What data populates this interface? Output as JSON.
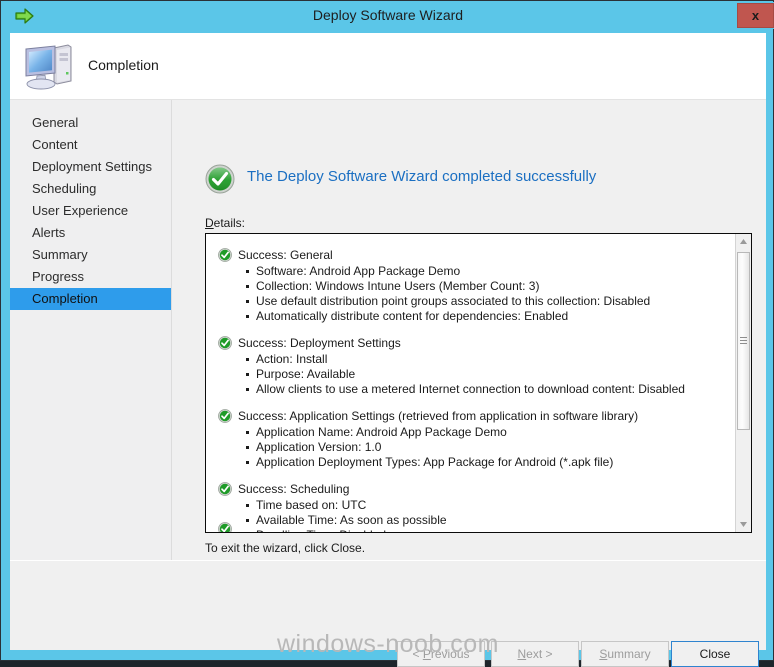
{
  "window": {
    "title": "Deploy Software Wizard",
    "app_icon": "green-arrow-icon",
    "close_label": "x",
    "frame_color": "#5bc6e8",
    "close_button_color": "#c0564f"
  },
  "header": {
    "title": "Completion",
    "icon": "computer-icon"
  },
  "sidebar": {
    "items": [
      {
        "label": "General",
        "selected": false
      },
      {
        "label": "Content",
        "selected": false
      },
      {
        "label": "Deployment Settings",
        "selected": false
      },
      {
        "label": "Scheduling",
        "selected": false
      },
      {
        "label": "User Experience",
        "selected": false
      },
      {
        "label": "Alerts",
        "selected": false
      },
      {
        "label": "Summary",
        "selected": false
      },
      {
        "label": "Progress",
        "selected": false
      },
      {
        "label": "Completion",
        "selected": true
      }
    ],
    "selected_color": "#2e9ceb"
  },
  "main": {
    "success_message": "The Deploy Software Wizard completed successfully",
    "success_message_color": "#1b6fc2",
    "success_icon": "green-check-circle-icon",
    "details_label_accel": "D",
    "details_label_rest": "etails:",
    "exit_text": "To exit the wizard, click Close.",
    "detail_groups": [
      {
        "icon": "green-check-circle-icon",
        "heading": "Success: General",
        "items": [
          "Software: Android App Package Demo",
          "Collection: Windows Intune Users (Member Count: 3)",
          "Use default distribution point groups associated to this collection: Disabled",
          "Automatically distribute content for dependencies: Enabled"
        ]
      },
      {
        "icon": "green-check-circle-icon",
        "heading": "Success: Deployment Settings",
        "items": [
          "Action: Install",
          "Purpose: Available",
          "Allow clients to use a metered Internet connection to download content: Disabled"
        ]
      },
      {
        "icon": "green-check-circle-icon",
        "heading": "Success: Application Settings (retrieved from application in software library)",
        "items": [
          "Application Name: Android App Package Demo",
          "Application Version: 1.0",
          "Application Deployment Types: App Package for Android (*.apk file)"
        ]
      },
      {
        "icon": "green-check-circle-icon",
        "heading": "Success: Scheduling",
        "items": [
          "Time based on: UTC",
          "Available Time: As soon as possible",
          "Deadline Time: Disabled"
        ]
      }
    ],
    "scrollbar": {
      "up_arrow": "scroll-up-arrow-icon",
      "down_arrow": "scroll-down-arrow-icon"
    }
  },
  "footer": {
    "buttons": [
      {
        "name": "previous",
        "accel": "P",
        "before": "< ",
        "after": "revious",
        "state": "disabled"
      },
      {
        "name": "next",
        "accel": "N",
        "before": "",
        "after": "ext >",
        "state": "disabled"
      },
      {
        "name": "summary",
        "accel": "S",
        "before": "",
        "after": "ummary",
        "state": "disabled"
      },
      {
        "name": "close",
        "accel": "",
        "before": "",
        "after": "Close",
        "state": "primary"
      }
    ]
  },
  "watermark": {
    "text": "windows-noob.com"
  }
}
